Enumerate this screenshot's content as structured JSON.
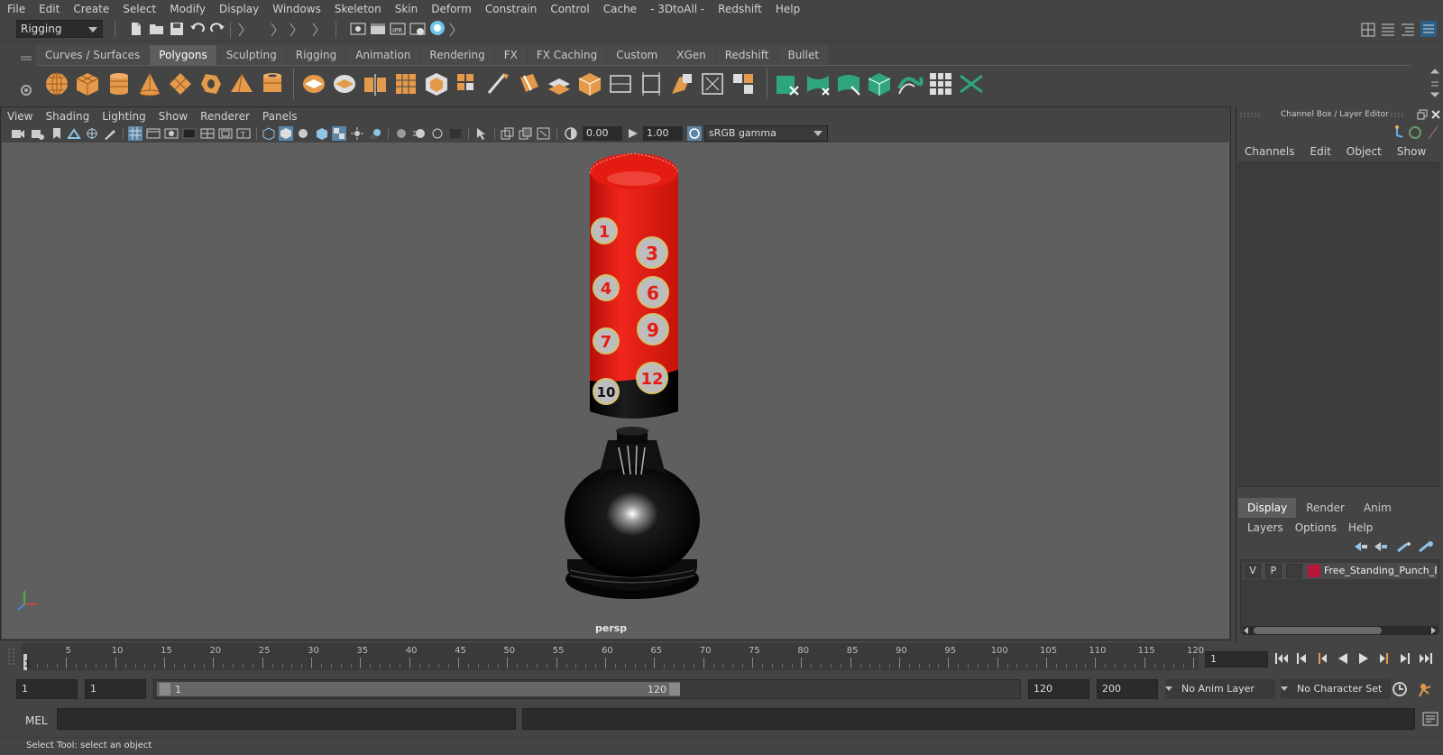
{
  "menubar": {
    "items": [
      "File",
      "Edit",
      "Create",
      "Select",
      "Modify",
      "Display",
      "Windows",
      "Skeleton",
      "Skin",
      "Deform",
      "Constrain",
      "Control",
      "Cache",
      "- 3DtoAll -",
      "Redshift",
      "Help"
    ]
  },
  "statusline": {
    "menuset": "Rigging"
  },
  "shelf": {
    "tabs": [
      "Curves / Surfaces",
      "Polygons",
      "Sculpting",
      "Rigging",
      "Animation",
      "Rendering",
      "FX",
      "FX Caching",
      "Custom",
      "XGen",
      "Redshift",
      "Bullet"
    ],
    "active_tab": "Polygons"
  },
  "panel": {
    "menus": [
      "View",
      "Shading",
      "Lighting",
      "Show",
      "Renderer",
      "Panels"
    ],
    "exposure": "0.00",
    "gamma": "1.00",
    "color_space": "sRGB gamma",
    "camera": "persp"
  },
  "model": {
    "numbers": [
      "1",
      "3",
      "4",
      "6",
      "9",
      "7",
      "12",
      "10"
    ],
    "colors": {
      "bag_red": "#e51b12",
      "base_black": "#0a0a0a",
      "target_gray": "#bdbdbd",
      "target_ring": "#d4c26a"
    }
  },
  "channel_box": {
    "title": "Channel Box / Layer Editor",
    "menus": [
      "Channels",
      "Edit",
      "Object",
      "Show"
    ]
  },
  "layer_editor": {
    "tabs": [
      "Display",
      "Render",
      "Anim"
    ],
    "active_tab": "Display",
    "menus": [
      "Layers",
      "Options",
      "Help"
    ],
    "layer": {
      "v": "V",
      "p": "P",
      "name": "Free_Standing_Punch_Bag",
      "color": "#b5183a"
    }
  },
  "timeline": {
    "ticks": [
      "5",
      "10",
      "15",
      "20",
      "25",
      "30",
      "35",
      "40",
      "45",
      "50",
      "55",
      "60",
      "65",
      "70",
      "75",
      "80",
      "85",
      "90",
      "95",
      "100",
      "105",
      "110",
      "115",
      "120"
    ],
    "current": "1",
    "current_frame_field": "1"
  },
  "range": {
    "start": "1",
    "anim_start": "1",
    "slider_start": "1",
    "slider_end": "120",
    "end": "120",
    "anim_end": "200",
    "anim_layer": "No Anim Layer",
    "character_set": "No Character Set"
  },
  "command": {
    "label": "MEL",
    "help": "Select Tool: select an object"
  }
}
